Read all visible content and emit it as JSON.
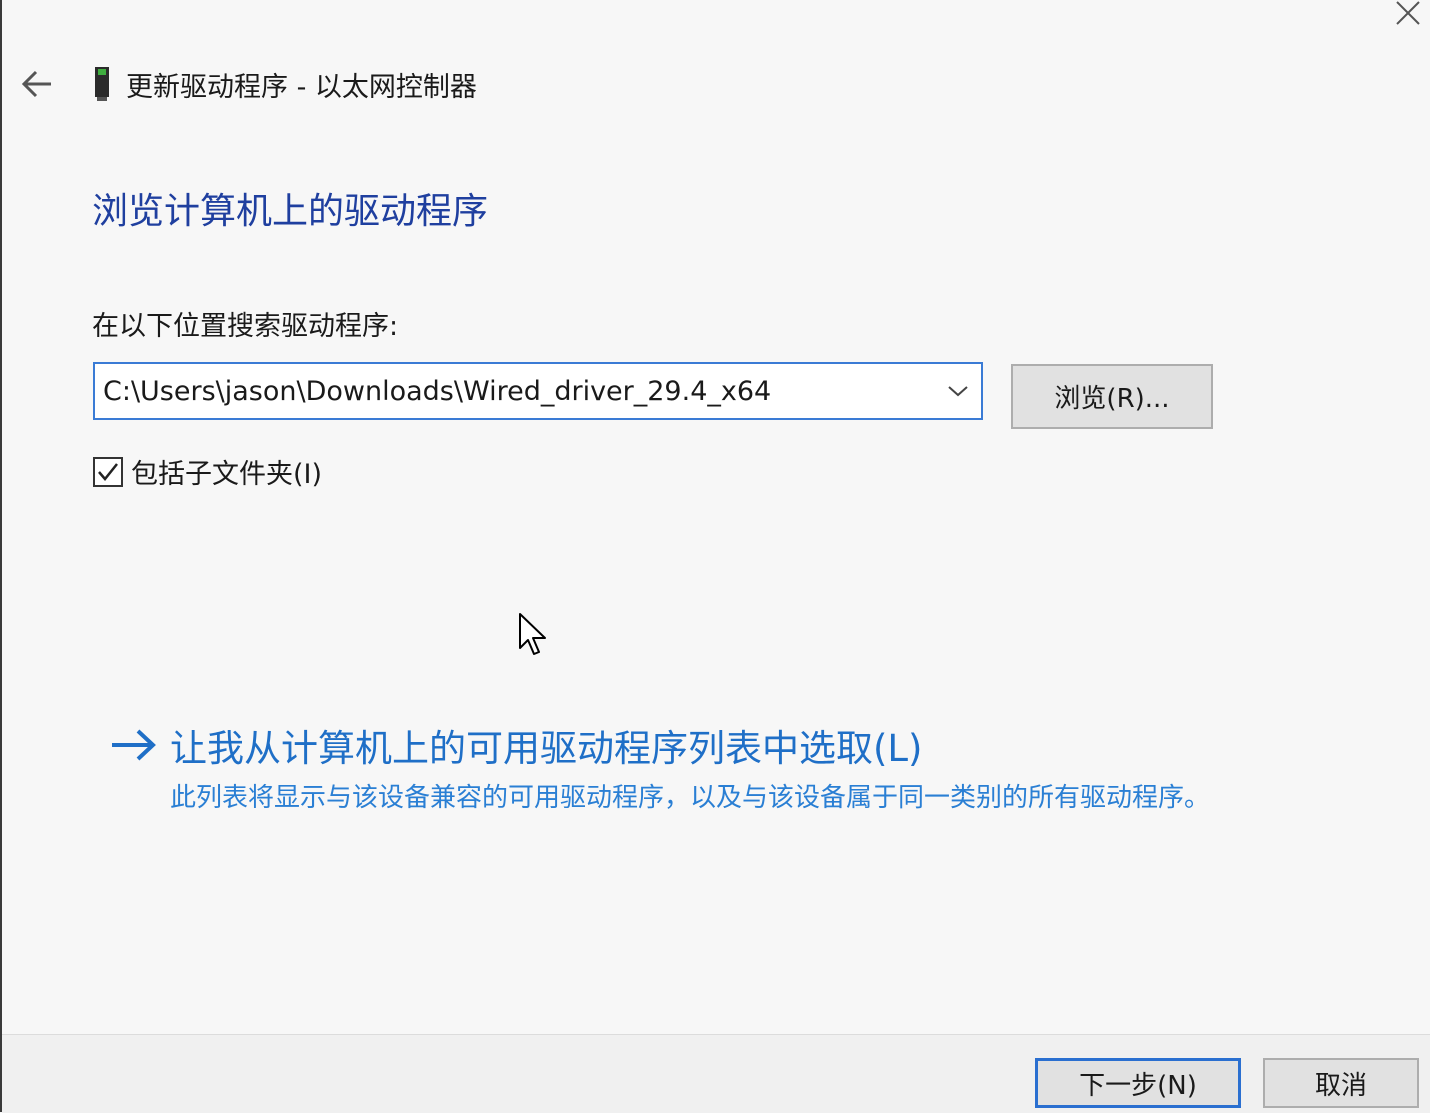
{
  "window": {
    "title": "更新驱动程序 - 以太网控制器"
  },
  "page": {
    "heading": "浏览计算机上的驱动程序",
    "search_label": "在以下位置搜索驱动程序:",
    "path_value": "C:\\Users\\jason\\Downloads\\Wired_driver_29.4_x64",
    "browse_label": "浏览(R)...",
    "include_subfolders_label": "包括子文件夹(I)",
    "include_subfolders_checked": true,
    "pick_link_title": "让我从计算机上的可用驱动程序列表中选取(L)",
    "pick_link_desc": "此列表将显示与该设备兼容的可用驱动程序，以及与该设备属于同一类别的所有驱动程序。"
  },
  "footer": {
    "next_label": "下一步(N)",
    "cancel_label": "取消"
  },
  "colors": {
    "heading": "#1f3f9f",
    "link": "#1f6fc7",
    "focus_border": "#3a7bd5"
  },
  "icons": {
    "close": "close-icon",
    "back": "back-arrow-icon",
    "device": "network-adapter-icon",
    "dropdown": "chevron-down-icon",
    "check": "checkmark-icon",
    "link_arrow": "arrow-right-icon",
    "cursor": "mouse-pointer-icon"
  }
}
